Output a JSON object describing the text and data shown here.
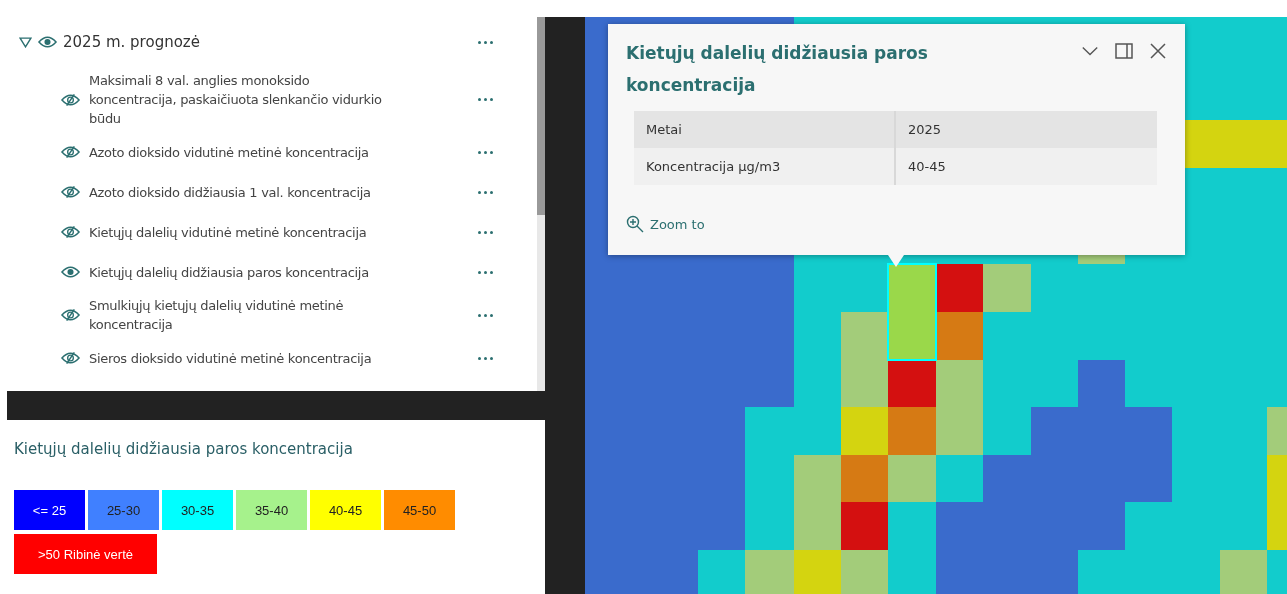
{
  "layer_list": {
    "group": {
      "title": "2025 m. prognozė",
      "expanded": true,
      "visible": true,
      "children": [
        {
          "label": "Maksimali 8 val. anglies monoksido koncentracija, paskaičiuota slenkančio vidurkio būdu",
          "visible": false
        },
        {
          "label": "Azoto dioksido vidutinė metinė koncentracija",
          "visible": false
        },
        {
          "label": "Azoto dioksido didžiausia 1 val. koncentracija",
          "visible": false
        },
        {
          "label": "Kietųjų dalelių vidutinė metinė koncentracija",
          "visible": false
        },
        {
          "label": "Kietųjų dalelių didžiausia paros koncentracija",
          "visible": true
        },
        {
          "label": "Smulkiųjų kietųjų dalelių vidutinė metinė koncentracija",
          "visible": false
        },
        {
          "label": "Sieros dioksido vidutinė metinė koncentracija",
          "visible": false
        }
      ]
    }
  },
  "legend": {
    "title": "Kietųjų dalelių didžiausia paros koncentracija",
    "items": [
      {
        "label": "<= 25",
        "color": "#0000ff"
      },
      {
        "label": "25-30",
        "color": "#4080ff"
      },
      {
        "label": "30-35",
        "color": "#00ffff"
      },
      {
        "label": "35-40",
        "color": "#a6f28c"
      },
      {
        "label": "40-45",
        "color": "#ffff00"
      },
      {
        "label": "45-50",
        "color": "#ff8c00"
      },
      {
        "label": ">50 Ribinė vertė",
        "color": "#ff0000"
      }
    ]
  },
  "popup": {
    "title": "Kietųjų dalelių didžiausia paros koncentracija",
    "fields": [
      {
        "name": "Metai",
        "value": "2025"
      },
      {
        "name": "Koncentracija µg/m3",
        "value": "40-45"
      }
    ],
    "action": "Zoom to"
  }
}
